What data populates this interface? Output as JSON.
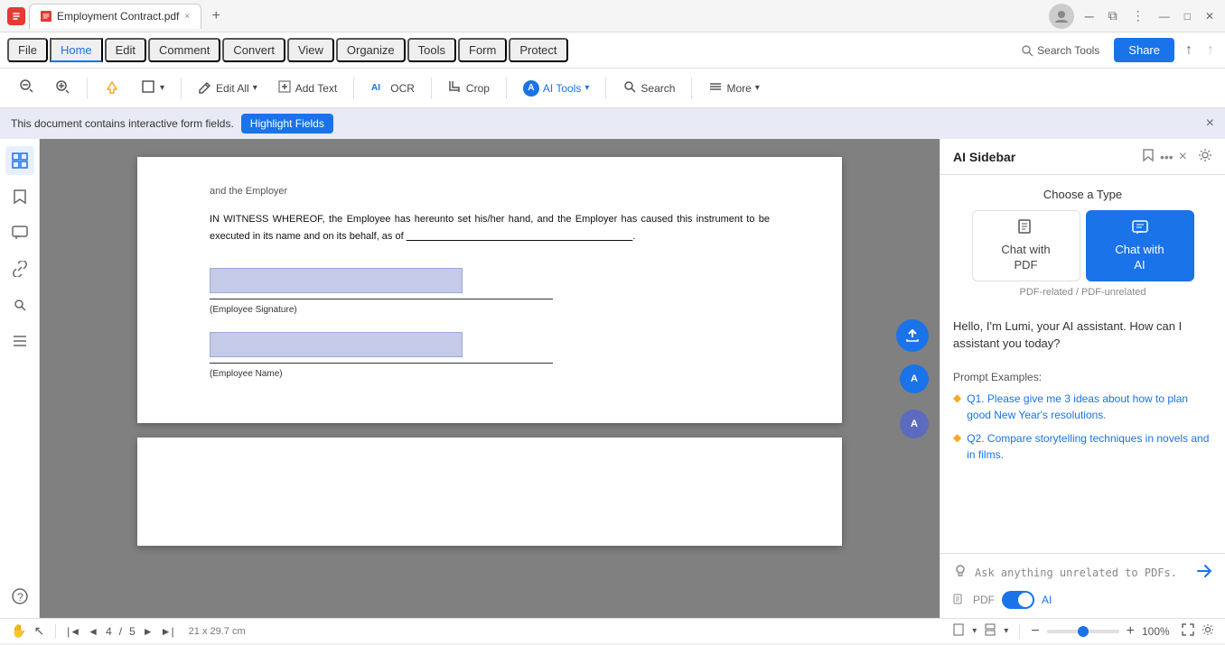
{
  "chrome": {
    "tab_title": "Employment Contract.pdf",
    "close_label": "×"
  },
  "menubar": {
    "items": [
      "File",
      "Home",
      "Edit",
      "Comment",
      "Convert",
      "View",
      "Organize",
      "Tools",
      "Form",
      "Protect"
    ],
    "active": "Home",
    "search_tools_label": "Search Tools",
    "share_label": "Share"
  },
  "toolbar": {
    "zoom_out_icon": "🔍",
    "zoom_in_icon": "🔍",
    "highlight_icon": "🖊",
    "select_icon": "□",
    "edit_all_label": "Edit All",
    "add_text_label": "Add Text",
    "ocr_label": "OCR",
    "crop_label": "Crop",
    "ai_tools_label": "AI Tools",
    "search_label": "Search",
    "more_label": "More"
  },
  "sidebar_icons": [
    {
      "name": "thumbnail-icon",
      "symbol": "⊞"
    },
    {
      "name": "bookmark-icon",
      "symbol": "🔖"
    },
    {
      "name": "comment-icon",
      "symbol": "💬"
    },
    {
      "name": "link-icon",
      "symbol": "🔗"
    },
    {
      "name": "search-sidebar-icon",
      "symbol": "🔍"
    },
    {
      "name": "layers-icon",
      "symbol": "≡"
    }
  ],
  "notification": {
    "text": "This document contains interactive form fields.",
    "button_label": "Highlight Fields",
    "close_icon": "×"
  },
  "pdf": {
    "content_line1": "and the Employer",
    "paragraph": "IN WITNESS WHEREOF, the Employee has hereunto set his/her hand, and the Employer has caused this instrument to be executed in its name and on its behalf, as of",
    "field1_label": "(Employee Signature)",
    "field2_label": "(Employee Name)"
  },
  "ai_sidebar": {
    "title": "AI Sidebar",
    "bookmark_icon": "🔖",
    "more_icon": "•••",
    "close_icon": "×",
    "settings_icon": "⚙",
    "choose_type_label": "Choose a Type",
    "chat_pdf_label": "Chat with\nPDF",
    "chat_ai_label": "Chat with\nAI",
    "subtitle": "PDF-related / PDF-unrelated",
    "greeting": "Hello, I'm Lumi, your AI assistant. How can I assistant you today?",
    "prompt_title": "Prompt Examples:",
    "prompts": [
      "Q1. Please give me 3 ideas about how to plan good New Year's resolutions.",
      "Q2. Compare storytelling techniques in novels and in films."
    ],
    "input_placeholder": "Ask anything unrelated to PDFs. Press '#' for Prompts.",
    "pdf_label": "PDF",
    "ai_label": "AI"
  },
  "status_bar": {
    "dimensions": "21 x 29.7 cm",
    "page_info": "4",
    "page_total": "5",
    "zoom_level": "100%"
  }
}
